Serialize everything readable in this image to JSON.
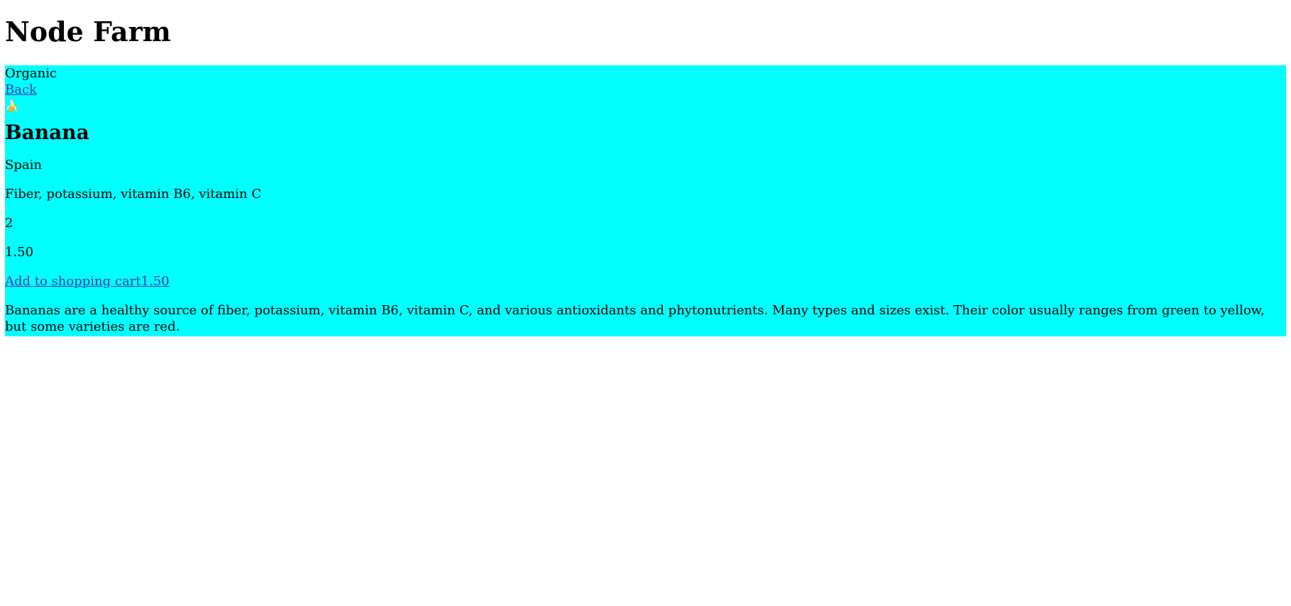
{
  "header": {
    "title": "Node Farm"
  },
  "product": {
    "badge": "Organic",
    "back_label": "Back",
    "image_emoji": "🍌",
    "name": "Banana",
    "origin": "Spain",
    "nutrients": "Fiber, potassium, vitamin B6, vitamin C",
    "quantity": "2",
    "price": "1.50",
    "add_to_cart_label": "Add to shopping cart1.50",
    "description": "Bananas are a healthy source of fiber, potassium, vitamin B6, vitamin C, and various antioxidants and phytonutrients. Many types and sizes exist. Their color usually ranges from green to yellow, but some varieties are red."
  },
  "colors": {
    "product_background": "#00ffff",
    "link": "#3b3bb0"
  }
}
